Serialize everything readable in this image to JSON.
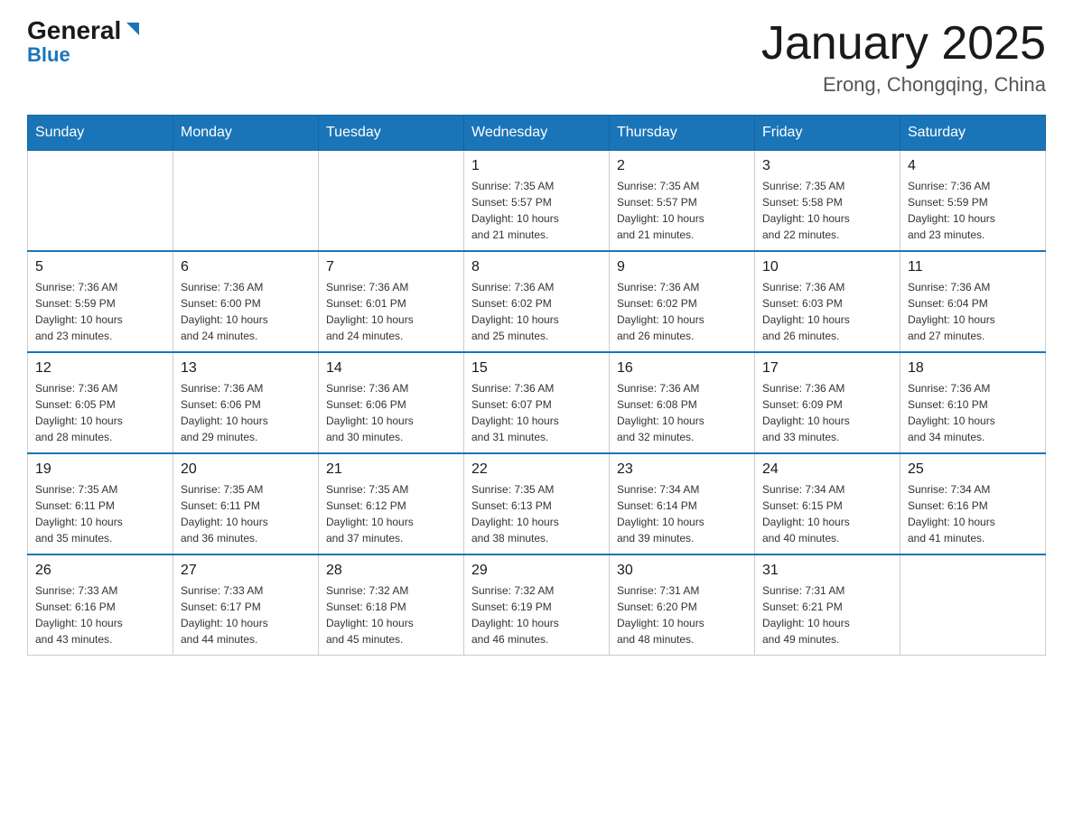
{
  "header": {
    "logo_general": "General",
    "logo_blue": "Blue",
    "month_title": "January 2025",
    "location": "Erong, Chongqing, China"
  },
  "days_of_week": [
    "Sunday",
    "Monday",
    "Tuesday",
    "Wednesday",
    "Thursday",
    "Friday",
    "Saturday"
  ],
  "weeks": [
    [
      {
        "day": "",
        "info": ""
      },
      {
        "day": "",
        "info": ""
      },
      {
        "day": "",
        "info": ""
      },
      {
        "day": "1",
        "info": "Sunrise: 7:35 AM\nSunset: 5:57 PM\nDaylight: 10 hours\nand 21 minutes."
      },
      {
        "day": "2",
        "info": "Sunrise: 7:35 AM\nSunset: 5:57 PM\nDaylight: 10 hours\nand 21 minutes."
      },
      {
        "day": "3",
        "info": "Sunrise: 7:35 AM\nSunset: 5:58 PM\nDaylight: 10 hours\nand 22 minutes."
      },
      {
        "day": "4",
        "info": "Sunrise: 7:36 AM\nSunset: 5:59 PM\nDaylight: 10 hours\nand 23 minutes."
      }
    ],
    [
      {
        "day": "5",
        "info": "Sunrise: 7:36 AM\nSunset: 5:59 PM\nDaylight: 10 hours\nand 23 minutes."
      },
      {
        "day": "6",
        "info": "Sunrise: 7:36 AM\nSunset: 6:00 PM\nDaylight: 10 hours\nand 24 minutes."
      },
      {
        "day": "7",
        "info": "Sunrise: 7:36 AM\nSunset: 6:01 PM\nDaylight: 10 hours\nand 24 minutes."
      },
      {
        "day": "8",
        "info": "Sunrise: 7:36 AM\nSunset: 6:02 PM\nDaylight: 10 hours\nand 25 minutes."
      },
      {
        "day": "9",
        "info": "Sunrise: 7:36 AM\nSunset: 6:02 PM\nDaylight: 10 hours\nand 26 minutes."
      },
      {
        "day": "10",
        "info": "Sunrise: 7:36 AM\nSunset: 6:03 PM\nDaylight: 10 hours\nand 26 minutes."
      },
      {
        "day": "11",
        "info": "Sunrise: 7:36 AM\nSunset: 6:04 PM\nDaylight: 10 hours\nand 27 minutes."
      }
    ],
    [
      {
        "day": "12",
        "info": "Sunrise: 7:36 AM\nSunset: 6:05 PM\nDaylight: 10 hours\nand 28 minutes."
      },
      {
        "day": "13",
        "info": "Sunrise: 7:36 AM\nSunset: 6:06 PM\nDaylight: 10 hours\nand 29 minutes."
      },
      {
        "day": "14",
        "info": "Sunrise: 7:36 AM\nSunset: 6:06 PM\nDaylight: 10 hours\nand 30 minutes."
      },
      {
        "day": "15",
        "info": "Sunrise: 7:36 AM\nSunset: 6:07 PM\nDaylight: 10 hours\nand 31 minutes."
      },
      {
        "day": "16",
        "info": "Sunrise: 7:36 AM\nSunset: 6:08 PM\nDaylight: 10 hours\nand 32 minutes."
      },
      {
        "day": "17",
        "info": "Sunrise: 7:36 AM\nSunset: 6:09 PM\nDaylight: 10 hours\nand 33 minutes."
      },
      {
        "day": "18",
        "info": "Sunrise: 7:36 AM\nSunset: 6:10 PM\nDaylight: 10 hours\nand 34 minutes."
      }
    ],
    [
      {
        "day": "19",
        "info": "Sunrise: 7:35 AM\nSunset: 6:11 PM\nDaylight: 10 hours\nand 35 minutes."
      },
      {
        "day": "20",
        "info": "Sunrise: 7:35 AM\nSunset: 6:11 PM\nDaylight: 10 hours\nand 36 minutes."
      },
      {
        "day": "21",
        "info": "Sunrise: 7:35 AM\nSunset: 6:12 PM\nDaylight: 10 hours\nand 37 minutes."
      },
      {
        "day": "22",
        "info": "Sunrise: 7:35 AM\nSunset: 6:13 PM\nDaylight: 10 hours\nand 38 minutes."
      },
      {
        "day": "23",
        "info": "Sunrise: 7:34 AM\nSunset: 6:14 PM\nDaylight: 10 hours\nand 39 minutes."
      },
      {
        "day": "24",
        "info": "Sunrise: 7:34 AM\nSunset: 6:15 PM\nDaylight: 10 hours\nand 40 minutes."
      },
      {
        "day": "25",
        "info": "Sunrise: 7:34 AM\nSunset: 6:16 PM\nDaylight: 10 hours\nand 41 minutes."
      }
    ],
    [
      {
        "day": "26",
        "info": "Sunrise: 7:33 AM\nSunset: 6:16 PM\nDaylight: 10 hours\nand 43 minutes."
      },
      {
        "day": "27",
        "info": "Sunrise: 7:33 AM\nSunset: 6:17 PM\nDaylight: 10 hours\nand 44 minutes."
      },
      {
        "day": "28",
        "info": "Sunrise: 7:32 AM\nSunset: 6:18 PM\nDaylight: 10 hours\nand 45 minutes."
      },
      {
        "day": "29",
        "info": "Sunrise: 7:32 AM\nSunset: 6:19 PM\nDaylight: 10 hours\nand 46 minutes."
      },
      {
        "day": "30",
        "info": "Sunrise: 7:31 AM\nSunset: 6:20 PM\nDaylight: 10 hours\nand 48 minutes."
      },
      {
        "day": "31",
        "info": "Sunrise: 7:31 AM\nSunset: 6:21 PM\nDaylight: 10 hours\nand 49 minutes."
      },
      {
        "day": "",
        "info": ""
      }
    ]
  ]
}
